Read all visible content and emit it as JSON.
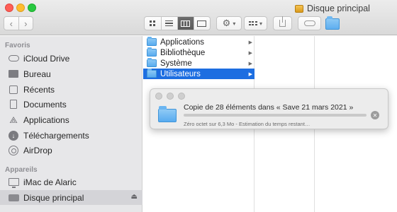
{
  "window": {
    "title": "Disque principal"
  },
  "toolbar": {
    "back_icon": "chevron-left",
    "forward_icon": "chevron-right",
    "view_modes": [
      "icon-view",
      "list-view",
      "column-view",
      "gallery-view"
    ],
    "active_view": "column-view",
    "action_icon": "gear",
    "arrange_icon": "arrange-grid",
    "share_icon": "share",
    "tag_icon": "tag",
    "folder_icon": "folder"
  },
  "sidebar": {
    "favorites_header": "Favoris",
    "favorites": [
      {
        "label": "iCloud Drive",
        "icon": "cloud"
      },
      {
        "label": "Bureau",
        "icon": "desktop"
      },
      {
        "label": "Récents",
        "icon": "clock"
      },
      {
        "label": "Documents",
        "icon": "document"
      },
      {
        "label": "Applications",
        "icon": "applications"
      },
      {
        "label": "Téléchargements",
        "icon": "download"
      },
      {
        "label": "AirDrop",
        "icon": "airdrop"
      }
    ],
    "devices_header": "Appareils",
    "devices": [
      {
        "label": "iMac de Alaric",
        "icon": "imac"
      },
      {
        "label": "Disque principal",
        "icon": "hard-drive",
        "selected": true
      }
    ]
  },
  "column1": {
    "items": [
      {
        "label": "Applications",
        "selected": false
      },
      {
        "label": "Bibliothèque",
        "selected": false
      },
      {
        "label": "Système",
        "selected": false
      },
      {
        "label": "Utilisateurs",
        "selected": true
      }
    ]
  },
  "copy_dialog": {
    "title": "Copie de 28 éléments dans « Save 21 mars 2021 »",
    "status": "Zéro octet sur 6,3 Mo - Estimation du temps restant…",
    "progress_percent": 0,
    "accent_color": "#1d6ee1"
  },
  "colors": {
    "selection": "#1d6ee1",
    "sidebar_bg": "#e7e7e9",
    "folder_blue": "#58abef"
  }
}
